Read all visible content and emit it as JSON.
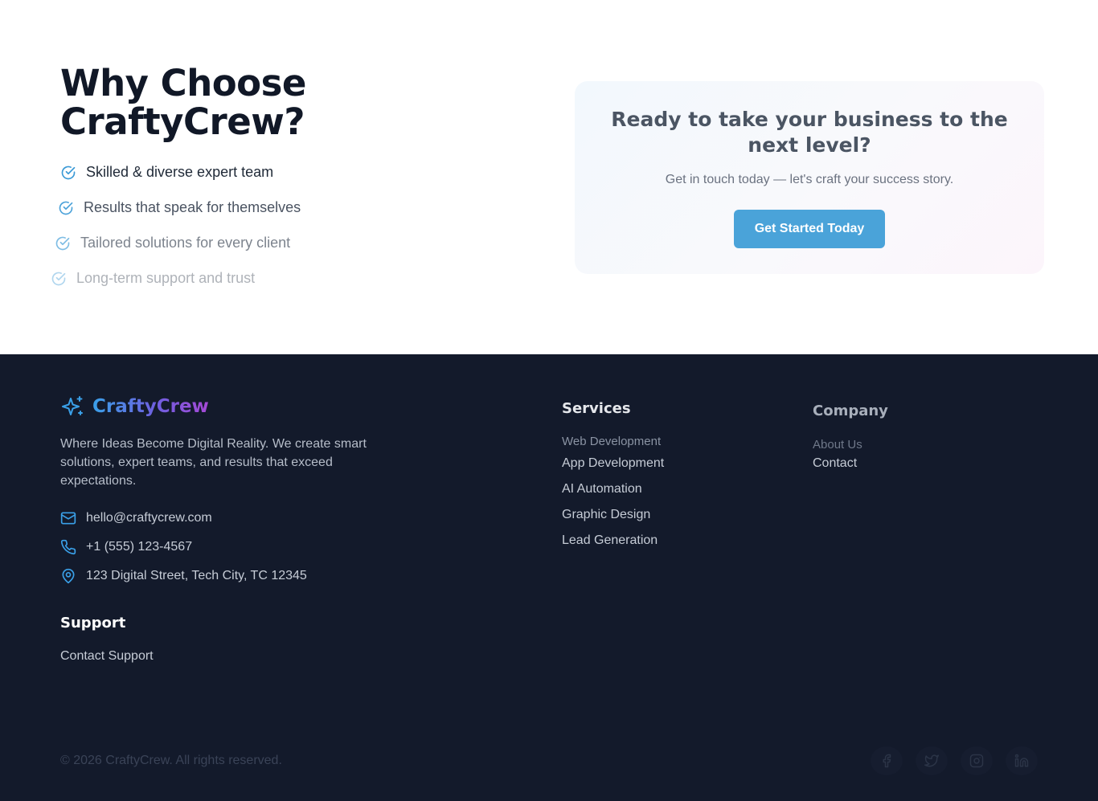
{
  "why": {
    "title_line1": "Why Choose",
    "title_line2": "CraftyCrew?",
    "features": [
      "Skilled & diverse expert team",
      "Results that speak for themselves",
      "Tailored solutions for every client",
      "Long-term support and trust"
    ]
  },
  "cta": {
    "title": "Ready to take your business to the next level?",
    "subtitle": "Get in touch today — let's craft your success story.",
    "button_label": "Get Started Today"
  },
  "footer": {
    "brand": "CraftyCrew",
    "tagline": "Where Ideas Become Digital Reality. We create smart solutions, expert teams, and results that exceed expectations.",
    "contact": {
      "email": "hello@craftycrew.com",
      "phone": "+1 (555) 123-4567",
      "address": "123 Digital Street, Tech City, TC 12345"
    },
    "support": {
      "heading": "Support",
      "links": [
        "Contact Support"
      ]
    },
    "services": {
      "heading": "Services",
      "links": [
        "Web Development",
        "App Development",
        "AI Automation",
        "Graphic Design",
        "Lead Generation"
      ]
    },
    "company": {
      "heading": "Company",
      "links": [
        "About Us",
        "Contact"
      ]
    },
    "copyright": "© 2026 CraftyCrew. All rights reserved.",
    "social_icons": [
      "facebook-icon",
      "twitter-icon",
      "instagram-icon",
      "linkedin-icon"
    ]
  },
  "colors": {
    "accent": "#4aa3d9",
    "footer_bg": "#131a2b",
    "heading_dark": "#111827"
  }
}
